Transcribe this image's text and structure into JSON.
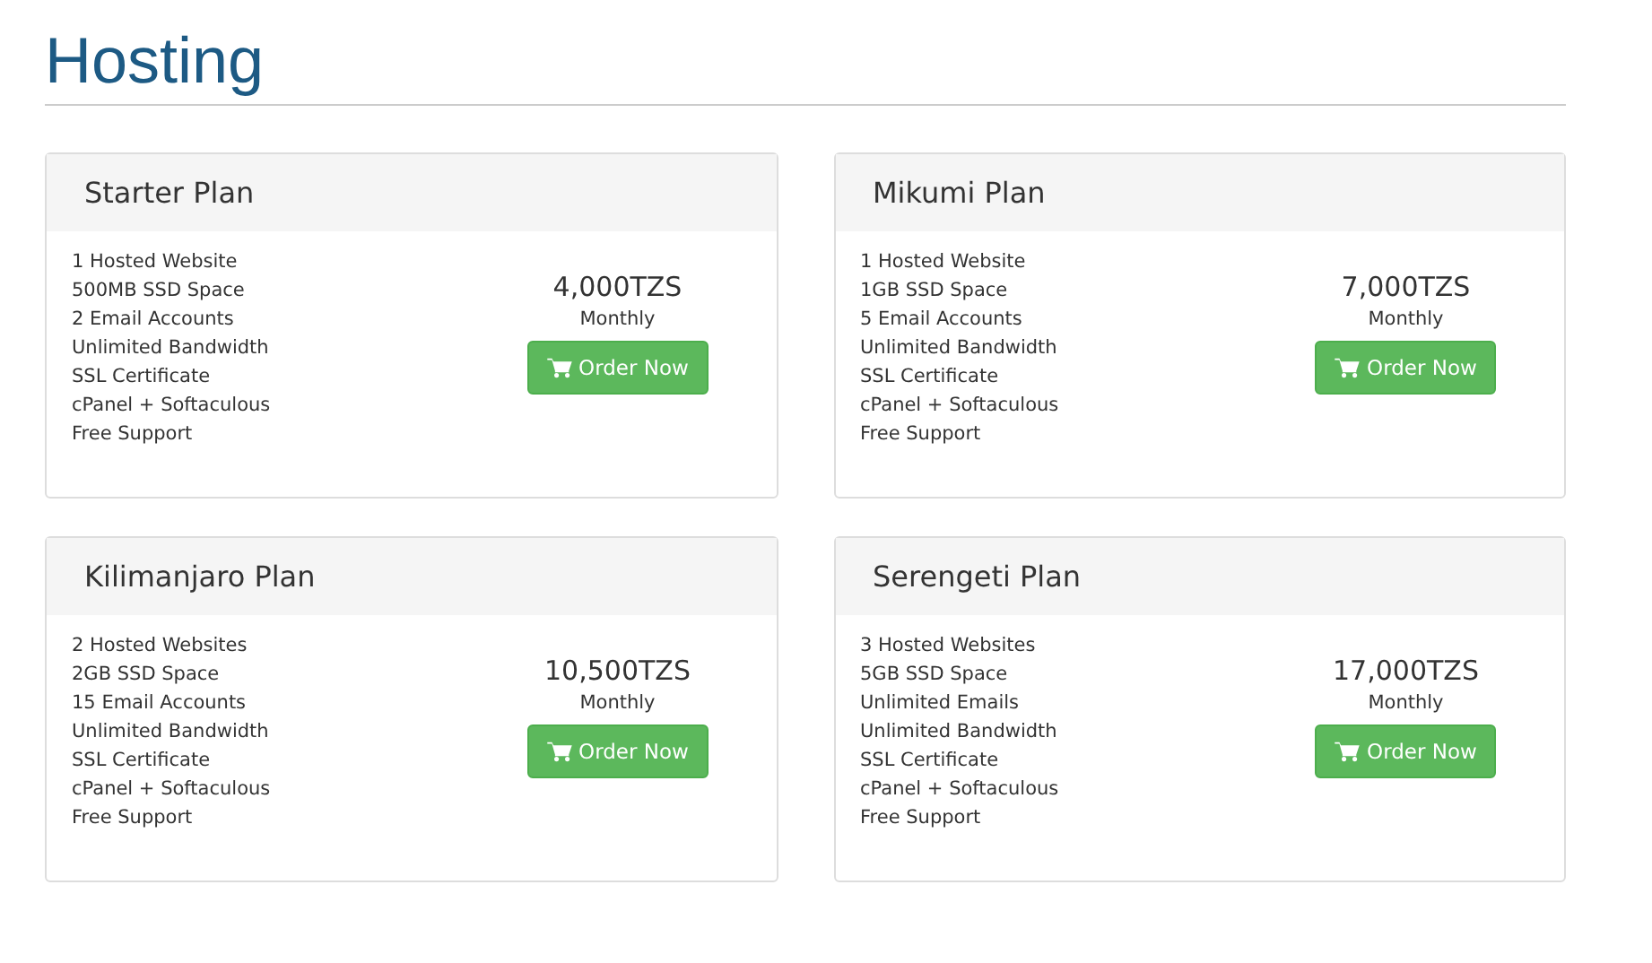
{
  "title": "Hosting",
  "plans": [
    {
      "name": "Starter Plan",
      "features": [
        "1 Hosted Website",
        "500MB SSD Space",
        "2 Email Accounts",
        "Unlimited Bandwidth",
        "SSL Certificate",
        "cPanel + Softaculous",
        "Free Support"
      ],
      "price": "4,000TZS",
      "period": "Monthly",
      "button": "Order Now"
    },
    {
      "name": "Mikumi Plan",
      "features": [
        "1 Hosted Website",
        "1GB SSD Space",
        "5 Email Accounts",
        "Unlimited Bandwidth",
        "SSL Certificate",
        "cPanel + Softaculous",
        "Free Support"
      ],
      "price": "7,000TZS",
      "period": "Monthly",
      "button": "Order Now"
    },
    {
      "name": "Kilimanjaro Plan",
      "features": [
        "2 Hosted Websites",
        "2GB SSD Space",
        "15 Email Accounts",
        "Unlimited Bandwidth",
        "SSL Certificate",
        "cPanel + Softaculous",
        "Free Support"
      ],
      "price": "10,500TZS",
      "period": "Monthly",
      "button": "Order Now"
    },
    {
      "name": "Serengeti Plan",
      "features": [
        "3 Hosted Websites",
        "5GB SSD Space",
        "Unlimited Emails",
        "Unlimited Bandwidth",
        "SSL Certificate",
        "cPanel + Softaculous",
        "Free Support"
      ],
      "price": "17,000TZS",
      "period": "Monthly",
      "button": "Order Now"
    }
  ]
}
